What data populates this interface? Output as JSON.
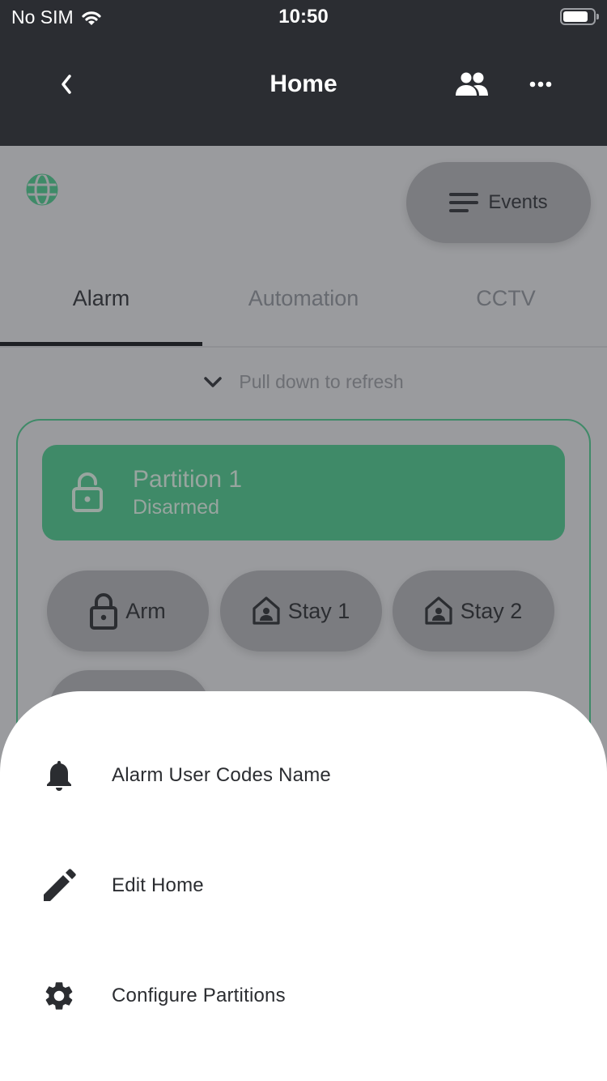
{
  "status_bar": {
    "carrier": "No SIM",
    "time": "10:50"
  },
  "nav": {
    "title": "Home",
    "back_icon": "chevron-left-icon",
    "users_icon": "people-icon",
    "more_icon": "more-horizontal-icon"
  },
  "header": {
    "globe_icon": "globe-icon",
    "events_label": "Events"
  },
  "tabs": [
    {
      "label": "Alarm",
      "active": true
    },
    {
      "label": "Automation",
      "active": false
    },
    {
      "label": "CCTV",
      "active": false
    }
  ],
  "refresh": {
    "label": "Pull down to refresh"
  },
  "partition": {
    "name": "Partition 1",
    "state": "Disarmed"
  },
  "actions": [
    {
      "label": "Arm",
      "icon": "lock-icon"
    },
    {
      "label": "Stay 1",
      "icon": "home-person-icon"
    },
    {
      "label": "Stay 2",
      "icon": "home-person-icon"
    }
  ],
  "sheet": {
    "items": [
      {
        "label": "Alarm User Codes Name",
        "icon": "bell-icon"
      },
      {
        "label": "Edit Home",
        "icon": "pencil-icon"
      },
      {
        "label": "Configure Partitions",
        "icon": "gear-icon"
      }
    ]
  },
  "colors": {
    "topbar": "#2b2d32",
    "accent_green": "#3f8a68",
    "overlay_gray": "#9a9b9e"
  }
}
